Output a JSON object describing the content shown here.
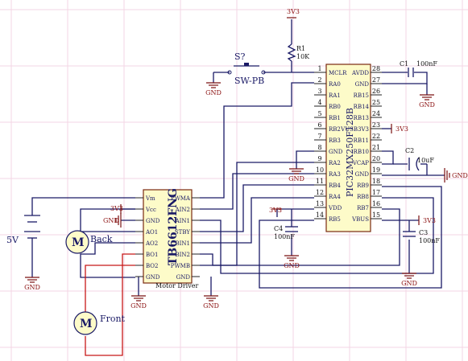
{
  "colors": {
    "wire": "#1a1a66",
    "motor_wire": "#c81818",
    "body": "#fdfbc9",
    "power": "#8b1010",
    "grid": "#f3d6e4"
  },
  "mcu": {
    "part": "PIC32MX250F128B",
    "left_pins": [
      {
        "num": "1",
        "name": "MCLR"
      },
      {
        "num": "2",
        "name": "RA0"
      },
      {
        "num": "3",
        "name": "RA1"
      },
      {
        "num": "4",
        "name": "RB0"
      },
      {
        "num": "5",
        "name": "RB1"
      },
      {
        "num": "6",
        "name": "RB2"
      },
      {
        "num": "7",
        "name": "RB3"
      },
      {
        "num": "8",
        "name": "GND"
      },
      {
        "num": "9",
        "name": "RA2"
      },
      {
        "num": "10",
        "name": "RA3"
      },
      {
        "num": "11",
        "name": "RB4"
      },
      {
        "num": "12",
        "name": "RA4"
      },
      {
        "num": "13",
        "name": "VDD"
      },
      {
        "num": "14",
        "name": "RB5"
      }
    ],
    "right_pins": [
      {
        "num": "28",
        "name": "AVDD"
      },
      {
        "num": "27",
        "name": "GND"
      },
      {
        "num": "26",
        "name": "RB15"
      },
      {
        "num": "25",
        "name": "RB14"
      },
      {
        "num": "24",
        "name": "RB13"
      },
      {
        "num": "23",
        "name": "VUSB3V3"
      },
      {
        "num": "22",
        "name": "RB11"
      },
      {
        "num": "21",
        "name": "RB10"
      },
      {
        "num": "20",
        "name": "VCAP"
      },
      {
        "num": "19",
        "name": "GND"
      },
      {
        "num": "18",
        "name": "RB9"
      },
      {
        "num": "17",
        "name": "RB8"
      },
      {
        "num": "16",
        "name": "RB7"
      },
      {
        "num": "15",
        "name": "VBUS"
      }
    ]
  },
  "driver": {
    "part": "TB6612FNG",
    "footer": "Motor Driver",
    "left_pins": [
      "Vm",
      "Vcc",
      "GND",
      "AO1",
      "AO2",
      "BO1",
      "BO2",
      "GND"
    ],
    "right_pins": [
      "PWMA",
      "AIN2",
      "AIN1",
      "STBY",
      "BIN1",
      "BIN2",
      "PWMB",
      "GND"
    ]
  },
  "labels": {
    "v3_top": "3V3",
    "r1": "R1",
    "r1_val": "10K",
    "switch_des": "S?",
    "switch_name": "SW-PB",
    "c1": "C1",
    "c1_val": "100nF",
    "c2": "C2",
    "c2_val": "10uF",
    "c3": "C3",
    "c3_val": "100nF",
    "c4": "C4",
    "c4_val": "100nF",
    "v3_vusb": "3V3",
    "v3_vdd": "3V3",
    "v3_vbus": "3V3",
    "v3_vcc": "3V3",
    "gnd": "GND",
    "battery": "5V",
    "motor_back": "Back",
    "motor_front": "Front",
    "motor_symbol": "M"
  }
}
